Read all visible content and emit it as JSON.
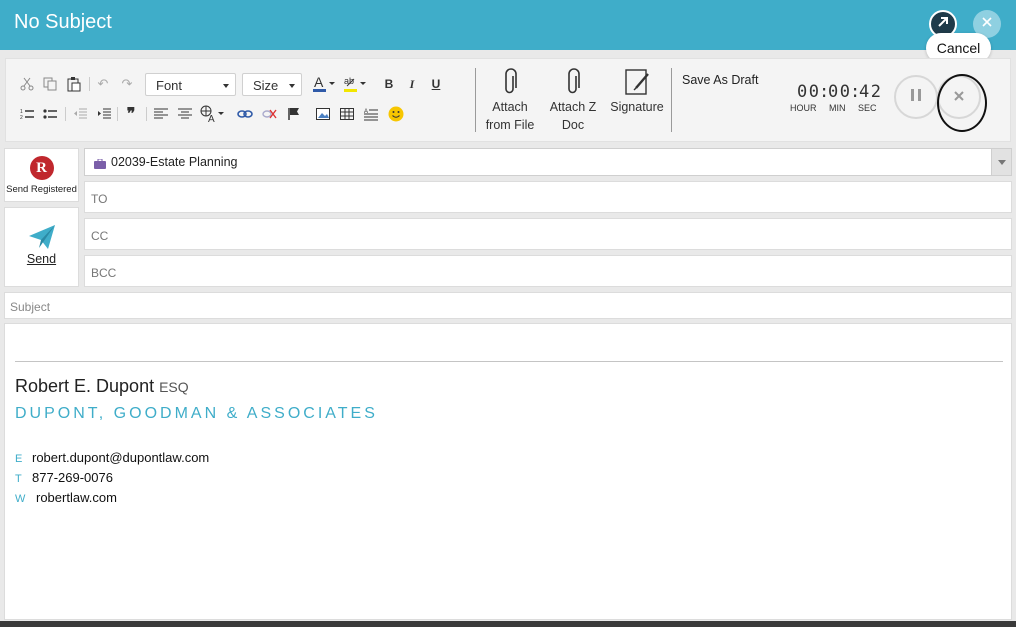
{
  "window": {
    "title": "No Subject",
    "tooltip": "Cancel"
  },
  "toolbar": {
    "font_label": "Font",
    "size_label": "Size",
    "attach_file_line1": "Attach",
    "attach_file_line2": "from File",
    "attach_z_line1": "Attach Z",
    "attach_z_line2": "Doc",
    "signature_label": "Signature",
    "save_draft_label": "Save As Draft"
  },
  "timer": {
    "hours": "00",
    "minutes": "00",
    "seconds": "42",
    "hour_label": "HOUR",
    "min_label": "MIN",
    "sec_label": "SEC"
  },
  "actions": {
    "send_registered_label": "Send Registered",
    "send_label": "Send"
  },
  "fields": {
    "matter_value": "02039-Estate Planning",
    "to_placeholder": "TO",
    "cc_placeholder": "CC",
    "bcc_placeholder": "BCC",
    "subject_placeholder": "Subject"
  },
  "signature": {
    "name": "Robert E. Dupont",
    "suffix": "ESQ",
    "firm": "DUPONT, GOODMAN & ASSOCIATES",
    "email_key": "E",
    "email": "robert.dupont@dupontlaw.com",
    "phone_key": "T",
    "phone": "877-269-0076",
    "web_key": "W",
    "web": "robertlaw.com"
  },
  "colors": {
    "brand": "#3fadc9",
    "registered_red": "#c0272d"
  }
}
